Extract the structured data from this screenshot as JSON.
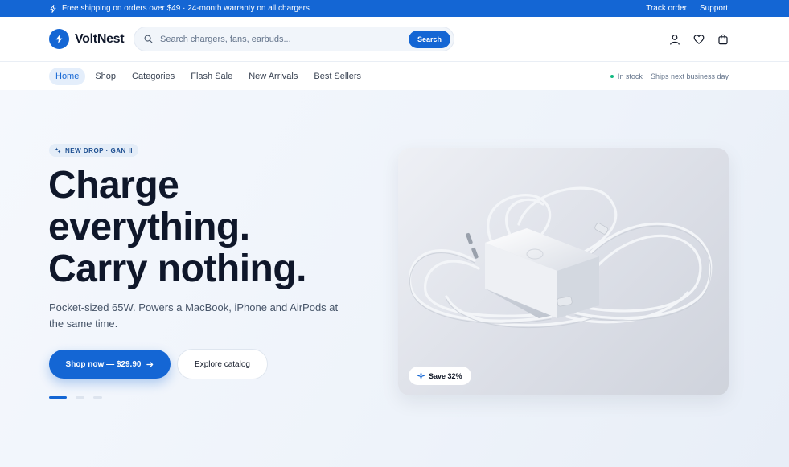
{
  "promo": {
    "message": "Free shipping on orders over $49 · 24-month warranty on all chargers",
    "links": [
      "Track order",
      "Support"
    ]
  },
  "header": {
    "brand": "VoltNest",
    "search_placeholder": "Search chargers, fans, earbuds...",
    "search_button": "Search",
    "icons": [
      "user-icon",
      "heart-icon",
      "cart-icon"
    ]
  },
  "nav": {
    "items": [
      "Home",
      "Shop",
      "Categories",
      "Flash Sale",
      "New Arrivals",
      "Best Sellers"
    ],
    "active": "Home",
    "status": "In stock",
    "shipping": "Ships next business day"
  },
  "hero": {
    "badge": "NEW DROP · GAN II",
    "headline": [
      "Charge",
      "everything.",
      "Carry nothing."
    ],
    "subhead": "Pocket-sized 65W. Powers a MacBook, iPhone and AirPods at the same time.",
    "primary_cta": "Shop now — $29.90",
    "secondary_cta": "Explore catalog",
    "slides": {
      "count": 3,
      "active": 1
    },
    "save_badge": "Save 32%"
  },
  "colors": {
    "accent": "#1466d4",
    "in_stock": "#10b981"
  }
}
